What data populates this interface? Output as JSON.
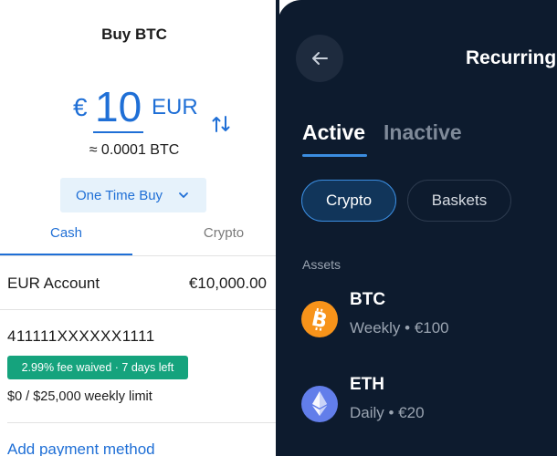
{
  "buy_screen": {
    "title": "Buy BTC",
    "currency_symbol": "€",
    "amount": "10",
    "currency_code": "EUR",
    "btc_equivalent": "≈ 0.0001 BTC",
    "frequency_button": "One Time Buy",
    "tabs": [
      "Cash",
      "Crypto"
    ],
    "active_tab": "Cash",
    "eur_account": {
      "label": "EUR Account",
      "balance": "€10,000.00"
    },
    "card": {
      "number": "411111XXXXXX1111",
      "fee_badge": "2.99% fee waived · 7 days left",
      "limit": "$0 / $25,000 weekly limit"
    },
    "add_payment": "Add payment method",
    "accent_color": "#1f6fd6",
    "badge_color": "#15a37d"
  },
  "recurring_screen": {
    "title": "Recurring",
    "tabs": {
      "active": "Active",
      "inactive": "Inactive"
    },
    "filters": {
      "crypto": "Crypto",
      "baskets": "Baskets"
    },
    "section_label": "Assets",
    "assets": [
      {
        "name": "BTC",
        "schedule": "Weekly • €100",
        "icon": "bitcoin-icon",
        "color": "#f7931a"
      },
      {
        "name": "ETH",
        "schedule": "Daily • €20",
        "icon": "ethereum-icon",
        "color": "#627eea"
      }
    ],
    "background_color": "#0d1b2e",
    "accent_color": "#3b8de0"
  }
}
